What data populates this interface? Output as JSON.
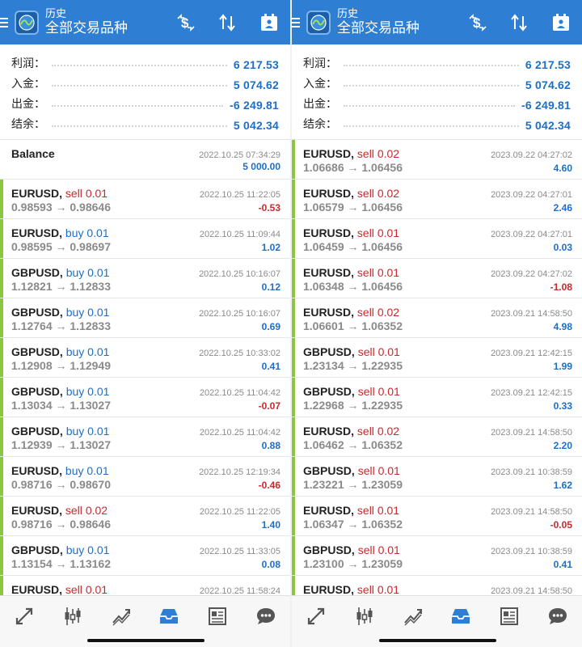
{
  "panels": [
    {
      "header": {
        "title_sub": "历史",
        "title_main": "全部交易品种"
      },
      "summary": [
        {
          "label": "利润：",
          "value": "6 217.53"
        },
        {
          "label": "入金：",
          "value": "5 074.62"
        },
        {
          "label": "出金：",
          "value": "-6 249.81"
        },
        {
          "label": "结余：",
          "value": "5 042.34"
        }
      ],
      "deals": [
        {
          "symbol": "Balance",
          "side": "",
          "volume": "",
          "prices": "",
          "time": "2022.10.25 07:34:29",
          "profit": "5 000.00",
          "profit_sign": "pos",
          "bar": false
        },
        {
          "symbol": "EURUSD,",
          "side": "sell",
          "volume": "0.01",
          "prices": "0.98593 → 0.98646",
          "time": "2022.10.25 11:22:05",
          "profit": "-0.53",
          "profit_sign": "neg",
          "bar": true
        },
        {
          "symbol": "EURUSD,",
          "side": "buy",
          "volume": "0.01",
          "prices": "0.98595 → 0.98697",
          "time": "2022.10.25 11:09:44",
          "profit": "1.02",
          "profit_sign": "pos",
          "bar": true
        },
        {
          "symbol": "GBPUSD,",
          "side": "buy",
          "volume": "0.01",
          "prices": "1.12821 → 1.12833",
          "time": "2022.10.25 10:16:07",
          "profit": "0.12",
          "profit_sign": "pos",
          "bar": true
        },
        {
          "symbol": "GBPUSD,",
          "side": "buy",
          "volume": "0.01",
          "prices": "1.12764 → 1.12833",
          "time": "2022.10.25 10:16:07",
          "profit": "0.69",
          "profit_sign": "pos",
          "bar": true
        },
        {
          "symbol": "GBPUSD,",
          "side": "buy",
          "volume": "0.01",
          "prices": "1.12908 → 1.12949",
          "time": "2022.10.25 10:33:02",
          "profit": "0.41",
          "profit_sign": "pos",
          "bar": true
        },
        {
          "symbol": "GBPUSD,",
          "side": "buy",
          "volume": "0.01",
          "prices": "1.13034 → 1.13027",
          "time": "2022.10.25 11:04:42",
          "profit": "-0.07",
          "profit_sign": "neg",
          "bar": true
        },
        {
          "symbol": "GBPUSD,",
          "side": "buy",
          "volume": "0.01",
          "prices": "1.12939 → 1.13027",
          "time": "2022.10.25 11:04:42",
          "profit": "0.88",
          "profit_sign": "pos",
          "bar": true
        },
        {
          "symbol": "EURUSD,",
          "side": "buy",
          "volume": "0.01",
          "prices": "0.98716 → 0.98670",
          "time": "2022.10.25 12:19:34",
          "profit": "-0.46",
          "profit_sign": "neg",
          "bar": true
        },
        {
          "symbol": "EURUSD,",
          "side": "sell",
          "volume": "0.02",
          "prices": "0.98716 → 0.98646",
          "time": "2022.10.25 11:22:05",
          "profit": "1.40",
          "profit_sign": "pos",
          "bar": true
        },
        {
          "symbol": "GBPUSD,",
          "side": "buy",
          "volume": "0.01",
          "prices": "1.13154 → 1.13162",
          "time": "2022.10.25 11:33:05",
          "profit": "0.08",
          "profit_sign": "pos",
          "bar": true
        },
        {
          "symbol": "EURUSD,",
          "side": "sell",
          "volume": "0.01",
          "prices": "",
          "time": "2022.10.25 11:58:24",
          "profit": "",
          "profit_sign": "pos",
          "bar": true
        }
      ]
    },
    {
      "header": {
        "title_sub": "历史",
        "title_main": "全部交易品种"
      },
      "summary": [
        {
          "label": "利润：",
          "value": "6 217.53"
        },
        {
          "label": "入金：",
          "value": "5 074.62"
        },
        {
          "label": "出金：",
          "value": "-6 249.81"
        },
        {
          "label": "结余：",
          "value": "5 042.34"
        }
      ],
      "deals": [
        {
          "symbol": "EURUSD,",
          "side": "sell",
          "volume": "0.02",
          "prices": "1.06686 → 1.06456",
          "time": "2023.09.22 04:27:02",
          "profit": "4.60",
          "profit_sign": "pos",
          "bar": true
        },
        {
          "symbol": "EURUSD,",
          "side": "sell",
          "volume": "0.02",
          "prices": "1.06579 → 1.06456",
          "time": "2023.09.22 04:27:01",
          "profit": "2.46",
          "profit_sign": "pos",
          "bar": true
        },
        {
          "symbol": "EURUSD,",
          "side": "sell",
          "volume": "0.01",
          "prices": "1.06459 → 1.06456",
          "time": "2023.09.22 04:27:01",
          "profit": "0.03",
          "profit_sign": "pos",
          "bar": true
        },
        {
          "symbol": "EURUSD,",
          "side": "sell",
          "volume": "0.01",
          "prices": "1.06348 → 1.06456",
          "time": "2023.09.22 04:27:02",
          "profit": "-1.08",
          "profit_sign": "neg",
          "bar": true
        },
        {
          "symbol": "EURUSD,",
          "side": "sell",
          "volume": "0.02",
          "prices": "1.06601 → 1.06352",
          "time": "2023.09.21 14:58:50",
          "profit": "4.98",
          "profit_sign": "pos",
          "bar": true
        },
        {
          "symbol": "GBPUSD,",
          "side": "sell",
          "volume": "0.01",
          "prices": "1.23134 → 1.22935",
          "time": "2023.09.21 12:42:15",
          "profit": "1.99",
          "profit_sign": "pos",
          "bar": true
        },
        {
          "symbol": "GBPUSD,",
          "side": "sell",
          "volume": "0.01",
          "prices": "1.22968 → 1.22935",
          "time": "2023.09.21 12:42:15",
          "profit": "0.33",
          "profit_sign": "pos",
          "bar": true
        },
        {
          "symbol": "EURUSD,",
          "side": "sell",
          "volume": "0.02",
          "prices": "1.06462 → 1.06352",
          "time": "2023.09.21 14:58:50",
          "profit": "2.20",
          "profit_sign": "pos",
          "bar": true
        },
        {
          "symbol": "GBPUSD,",
          "side": "sell",
          "volume": "0.01",
          "prices": "1.23221 → 1.23059",
          "time": "2023.09.21 10:38:59",
          "profit": "1.62",
          "profit_sign": "pos",
          "bar": true
        },
        {
          "symbol": "EURUSD,",
          "side": "sell",
          "volume": "0.01",
          "prices": "1.06347 → 1.06352",
          "time": "2023.09.21 14:58:50",
          "profit": "-0.05",
          "profit_sign": "neg",
          "bar": true
        },
        {
          "symbol": "GBPUSD,",
          "side": "sell",
          "volume": "0.01",
          "prices": "1.23100 → 1.23059",
          "time": "2023.09.21 10:38:59",
          "profit": "0.41",
          "profit_sign": "pos",
          "bar": true
        },
        {
          "symbol": "EURUSD,",
          "side": "sell",
          "volume": "0.01",
          "prices": "",
          "time": "2023.09.21 14:58:50",
          "profit": "",
          "profit_sign": "pos",
          "bar": true
        }
      ]
    }
  ],
  "icons": {
    "header": [
      "menu-icon",
      "app-logo-icon",
      "currency-exchange-icon",
      "sort-icon",
      "calendar-icon"
    ],
    "bottom_nav": [
      "quotes-icon",
      "chart-icon",
      "trade-icon",
      "history-icon",
      "news-icon",
      "chat-icon"
    ]
  },
  "colors": {
    "header_bg": "#2e7fd4",
    "buy": "#1c6fc7",
    "sell": "#c9282d",
    "bar": "#8cc63f",
    "active_tab": "#2e7fd4",
    "inactive_tab": "#555555"
  }
}
